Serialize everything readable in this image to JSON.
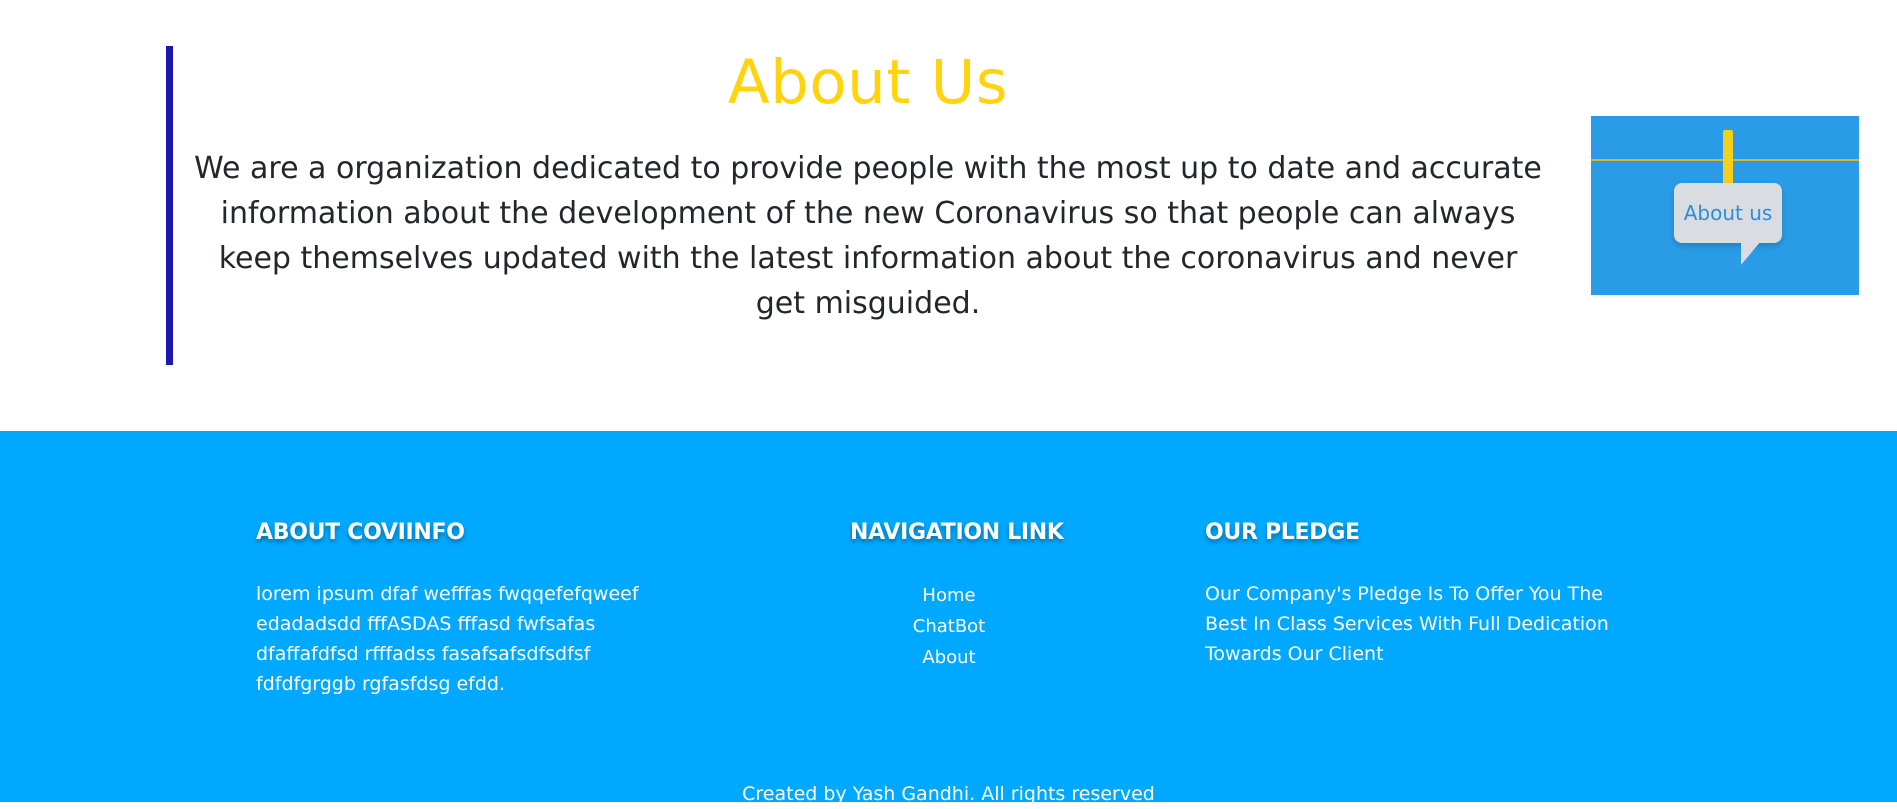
{
  "about": {
    "title": "About Us",
    "description": "We are a organization dedicated to provide people with the most up to date and accurate information about the development of the new Coronavirus so that people can always keep themselves updated with the latest information about the coronavirus and never get misguided.",
    "image_label": "About us",
    "colors": {
      "title": "#ffd40e",
      "accent_bar": "#1a16b0",
      "image_background": "#2a9be6"
    }
  },
  "footer": {
    "background": "#00a9ff",
    "about_column": {
      "heading": "ABOUT COVIINFO",
      "body": "lorem ipsum dfaf wefffas fwqqefefqweef edadadsdd fffASDAS fffasd fwfsafas dfaffafdfsd rfffadss fasafsafsdfsdfsf fdfdfgrggb rgfasfdsg efdd."
    },
    "nav_column": {
      "heading": "NAVIGATION LINK",
      "links": [
        {
          "label": "Home"
        },
        {
          "label": "ChatBot"
        },
        {
          "label": "About"
        }
      ]
    },
    "pledge_column": {
      "heading": "OUR PLEDGE",
      "body": "Our Company's Pledge Is To Offer You The Best In Class Services With Full Dedication Towards Our Client"
    },
    "copyright": "Created by Yash Gandhi. All rights reserved"
  }
}
